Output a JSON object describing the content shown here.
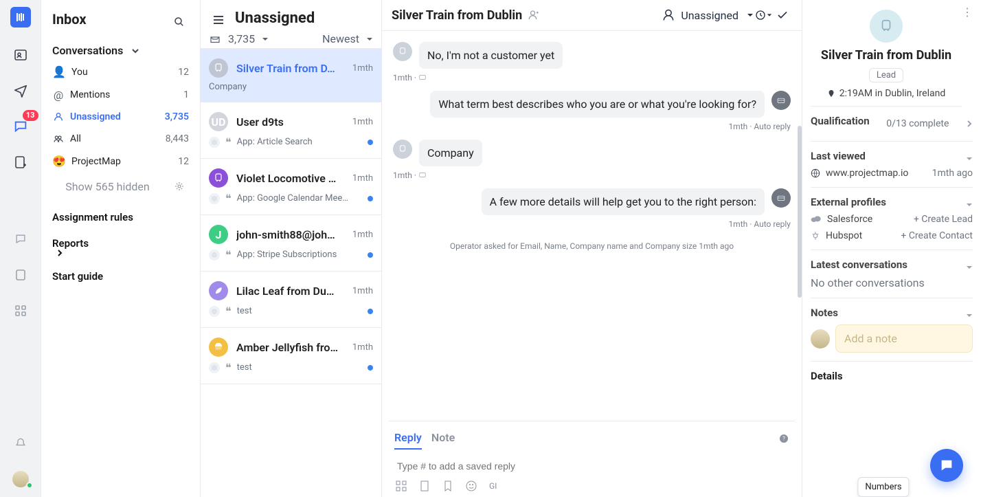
{
  "rail": {
    "unread_badge": "13"
  },
  "inbox": {
    "title": "Inbox",
    "section_label": "Conversations",
    "items": [
      {
        "avatar": "👤",
        "label": "You",
        "count": "12"
      },
      {
        "icon": "mention",
        "label": "Mentions",
        "count": "1"
      },
      {
        "icon": "unassigned",
        "label": "Unassigned",
        "count": "3,735",
        "selected": true
      },
      {
        "icon": "all",
        "label": "All",
        "count": "8,443"
      },
      {
        "avatar": "😍",
        "label": "ProjectMap",
        "count": "12"
      }
    ],
    "show_hidden": "Show 565 hidden",
    "footer": {
      "assignment_rules": "Assignment rules",
      "reports": "Reports",
      "start_guide": "Start guide"
    }
  },
  "list": {
    "title": "Unassigned",
    "count": "3,735",
    "sort": "Newest",
    "items": [
      {
        "name": "Silver Train from D…",
        "time": "1mth",
        "initials": "",
        "color": "#bfc6d1",
        "snippet": "Company",
        "selected": true,
        "icon": "train"
      },
      {
        "name": "User d9ts",
        "time": "1mth",
        "initials": "UD",
        "color": "#d2d5db",
        "snippet": "App: Article Search",
        "unread": true
      },
      {
        "name": "Violet Locomotive …",
        "time": "1mth",
        "initials": "",
        "color": "#8c4fd9",
        "snippet": "App: Google Calendar Mee…",
        "unread": true,
        "icon": "train"
      },
      {
        "name": "john-smith88@joh…",
        "time": "1mth",
        "initials": "J",
        "color": "#3dcd84",
        "snippet": "App: Stripe Subscriptions",
        "unread": true
      },
      {
        "name": "Lilac Leaf from Du…",
        "time": "1mth",
        "initials": "",
        "color": "#a18bea",
        "snippet": "test",
        "unread": true,
        "icon": "leaf"
      },
      {
        "name": "Amber Jellyfish fro…",
        "time": "1mth",
        "initials": "",
        "color": "#f4c044",
        "snippet": "test",
        "unread": true,
        "icon": "jelly"
      }
    ]
  },
  "chat": {
    "title": "Silver Train from Dublin",
    "assignee": "Unassigned",
    "messages": [
      {
        "side": "left",
        "text": "No, I'm not a customer yet",
        "meta": "1mth · ",
        "icon": "train"
      },
      {
        "side": "right",
        "text": "What term best describes who you are or what you're looking for?",
        "meta": "1mth · Auto reply",
        "icon": "bot"
      },
      {
        "side": "left",
        "text": "Company",
        "meta": "1mth · ",
        "icon": "train"
      },
      {
        "side": "right",
        "text": "A few more details will help get you to the right person:",
        "meta": "1mth · Auto reply",
        "icon": "bot"
      }
    ],
    "system_note": "Operator asked for Email, Name, Company name and Company size 1mth ago",
    "tabs": {
      "reply": "Reply",
      "note": "Note"
    },
    "compose_placeholder": "Type # to add a saved reply",
    "tooltip": "Numbers"
  },
  "inspector": {
    "name": "Silver Train from Dublin",
    "tag": "Lead",
    "location": "2:19AM in Dublin, Ireland",
    "qualification": {
      "title": "Qualification",
      "progress": "0/13 complete"
    },
    "last_viewed": {
      "title": "Last viewed",
      "site": "www.projectmap.io",
      "time": "1mth ago"
    },
    "external": {
      "title": "External profiles",
      "salesforce": "Salesforce",
      "salesforce_action": "+ Create Lead",
      "hubspot": "Hubspot",
      "hubspot_action": "+ Create Contact"
    },
    "latest": {
      "title": "Latest conversations",
      "empty": "No other conversations"
    },
    "notes": {
      "title": "Notes",
      "placeholder": "Add a note"
    },
    "details": {
      "title": "Details"
    }
  }
}
